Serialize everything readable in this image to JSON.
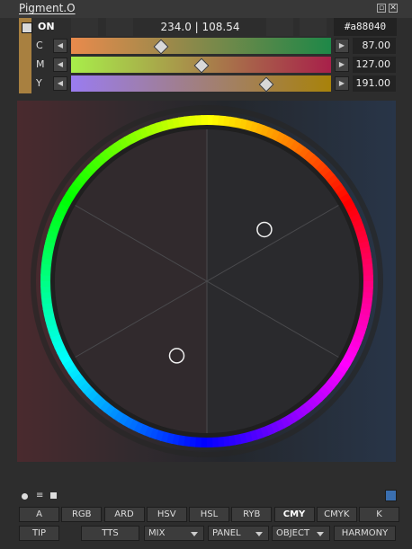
{
  "window": {
    "title": "Pigment.O"
  },
  "header": {
    "on_label": "ON",
    "on_checked": false,
    "coordinates": "234.0 | 108.54",
    "hex": "#a88040",
    "swatch_color": "#a88040"
  },
  "sliders": [
    {
      "label": "C",
      "value": "87.00",
      "fraction": 0.341,
      "gradient": [
        "#e98a4c",
        "#1e8848"
      ]
    },
    {
      "label": "M",
      "value": "127.00",
      "fraction": 0.498,
      "gradient": [
        "#a8ee4a",
        "#a8204a"
      ]
    },
    {
      "label": "Y",
      "value": "191.00",
      "fraction": 0.749,
      "gradient": [
        "#9a7cf0",
        "#a8820a"
      ]
    }
  ],
  "wheel": {
    "markers": [
      {
        "name": "marker-primary",
        "angle_deg": 48,
        "radius_frac": 0.5
      },
      {
        "name": "marker-secondary",
        "angle_deg": 202,
        "radius_frac": 0.52
      }
    ]
  },
  "bottom": {
    "mode_buttons": [
      "A",
      "RGB",
      "ARD",
      "HSV",
      "HSL",
      "RYB",
      "CMY",
      "CMYK",
      "K"
    ],
    "active_mode": "CMY",
    "second_row": {
      "tip": "TIP",
      "tts": "TTS",
      "mix": "MIX",
      "panel": "PANEL",
      "object": "OBJECT",
      "harmony": "HARMONY"
    }
  }
}
